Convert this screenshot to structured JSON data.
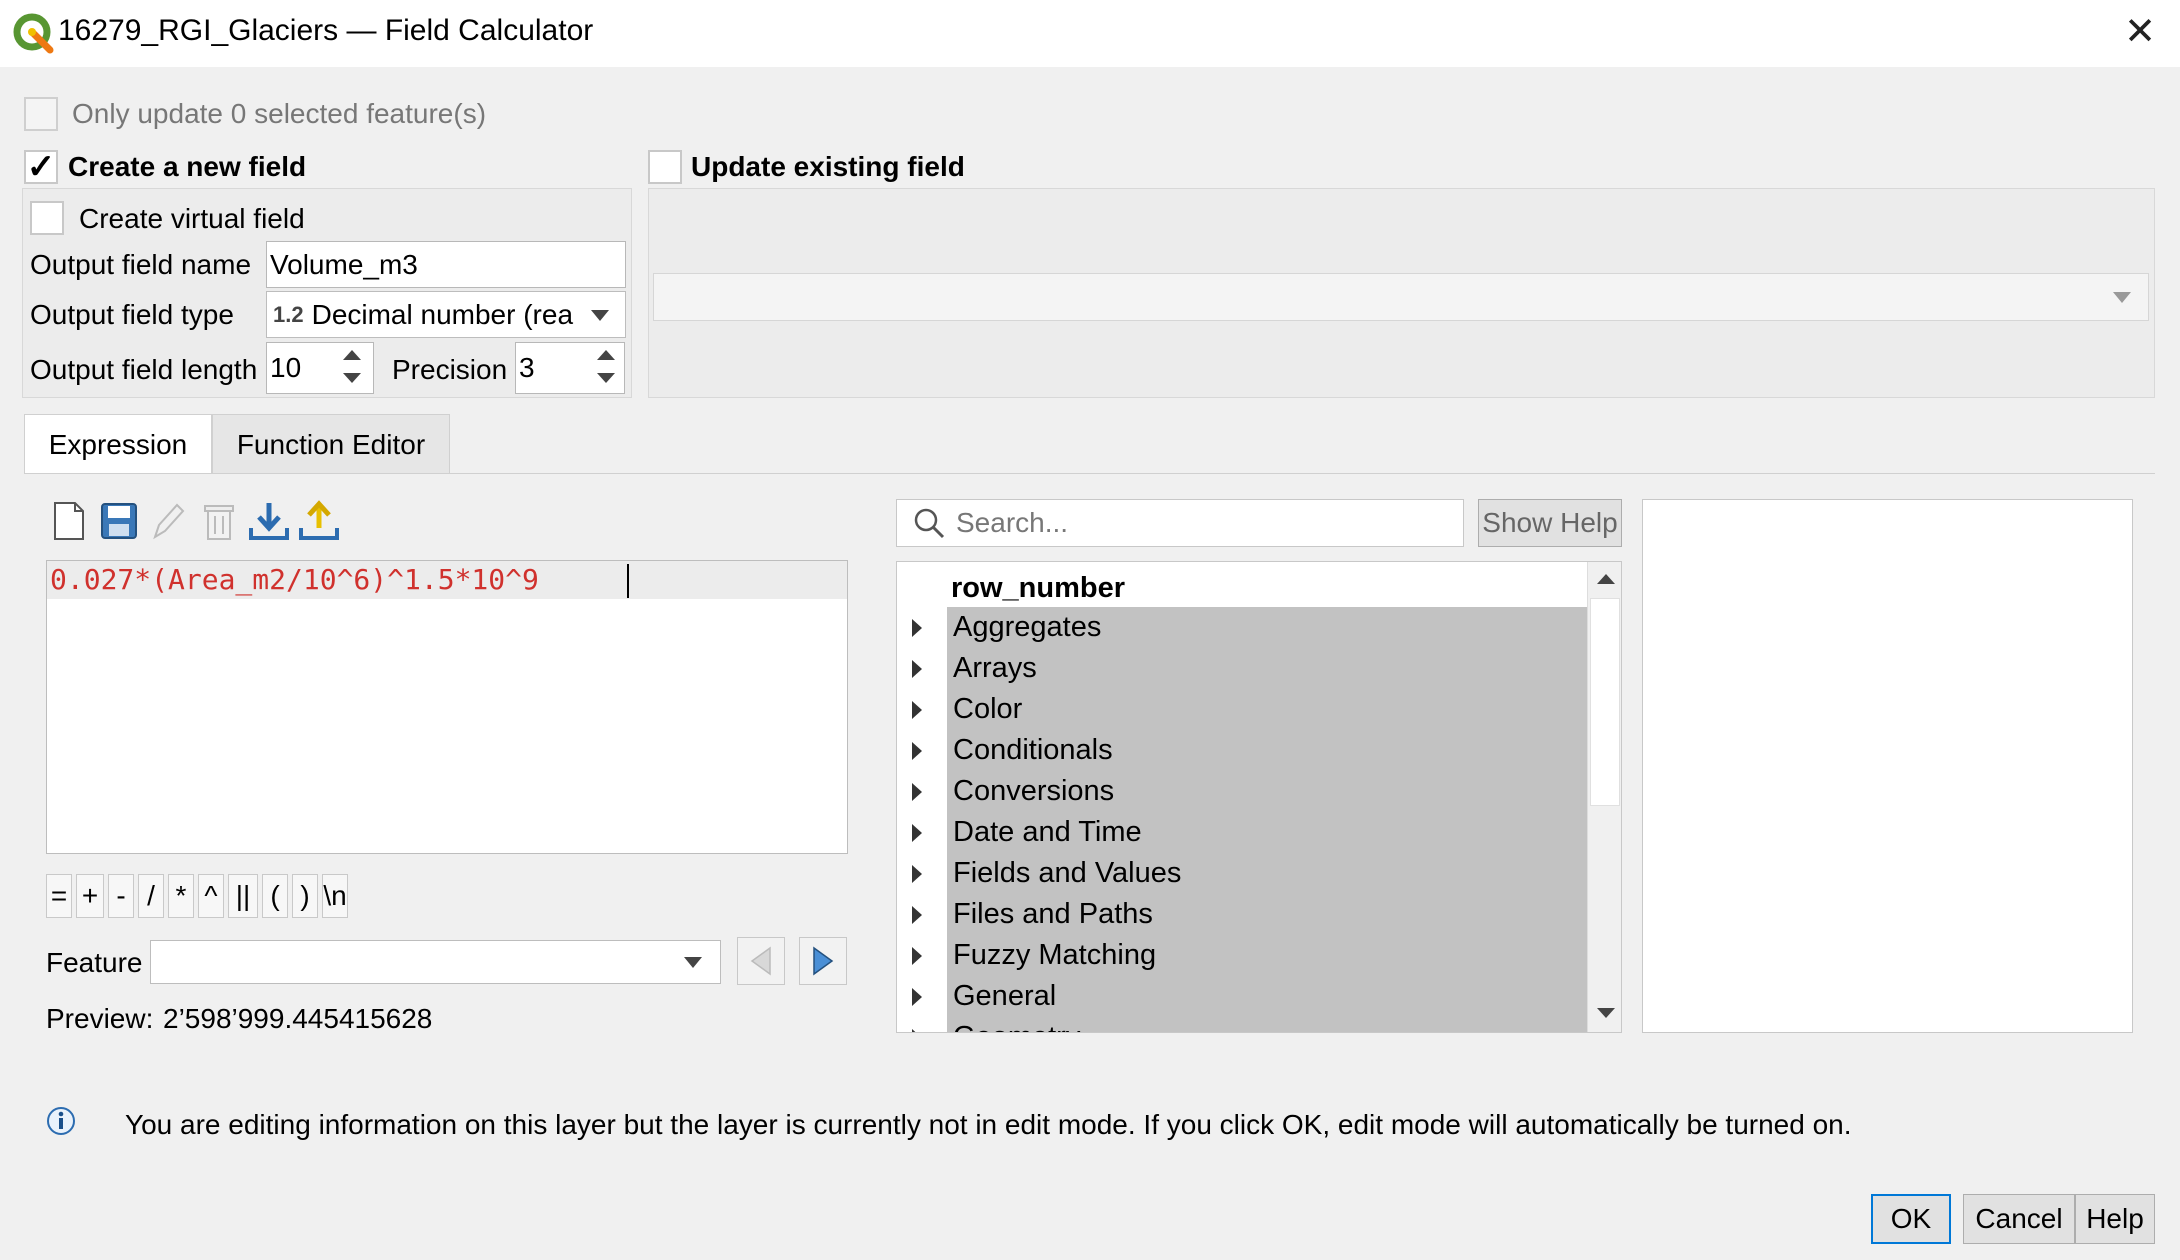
{
  "window": {
    "title": "16279_RGI_Glaciers — Field Calculator",
    "close_glyph": "✕"
  },
  "only_update": {
    "label": "Only update 0 selected feature(s)",
    "checked": false,
    "enabled": false
  },
  "create_new": {
    "label": "Create a new field",
    "checked": true,
    "virtual_label": "Create virtual field",
    "name_label": "Output field name",
    "name_value": "Volume_m3",
    "type_label": "Output field type",
    "type_prefix": "1.2",
    "type_value": "Decimal number (real)",
    "length_label": "Output field length",
    "length_value": "10",
    "precision_label": "Precision",
    "precision_value": "3"
  },
  "update_existing": {
    "label": "Update existing field",
    "checked": false,
    "field_value": ""
  },
  "tabs": [
    {
      "label": "Expression",
      "active": true
    },
    {
      "label": "Function Editor",
      "active": false
    }
  ],
  "toolbar": [
    {
      "name": "new-file-icon"
    },
    {
      "name": "save-icon"
    },
    {
      "name": "edit-icon"
    },
    {
      "name": "delete-icon"
    },
    {
      "name": "import-icon"
    },
    {
      "name": "export-icon"
    }
  ],
  "expression": "0.027*(Area_m2/10^6)^1.5*10^9",
  "operators": [
    "=",
    "+",
    "-",
    "/",
    "*",
    "^",
    "||",
    "(",
    ")",
    "\\n"
  ],
  "feature": {
    "label": "Feature",
    "value": ""
  },
  "preview": {
    "label": "Preview:",
    "value": "2’598’999.445415628"
  },
  "search": {
    "placeholder": "Search...",
    "show_help": "Show Help"
  },
  "functions": {
    "top_item": "row_number",
    "groups": [
      "Aggregates",
      "Arrays",
      "Color",
      "Conditionals",
      "Conversions",
      "Date and Time",
      "Fields and Values",
      "Files and Paths",
      "Fuzzy Matching",
      "General",
      "Geometry"
    ]
  },
  "info_message": "You are editing information on this layer but the layer is currently not in edit mode. If you click OK, edit mode will automatically be turned on.",
  "buttons": {
    "ok": "OK",
    "cancel": "Cancel",
    "help": "Help"
  },
  "colors": {
    "accent": "#0078d7",
    "expression_text": "#d0312d",
    "tree_highlight": "#c2c2c2"
  }
}
